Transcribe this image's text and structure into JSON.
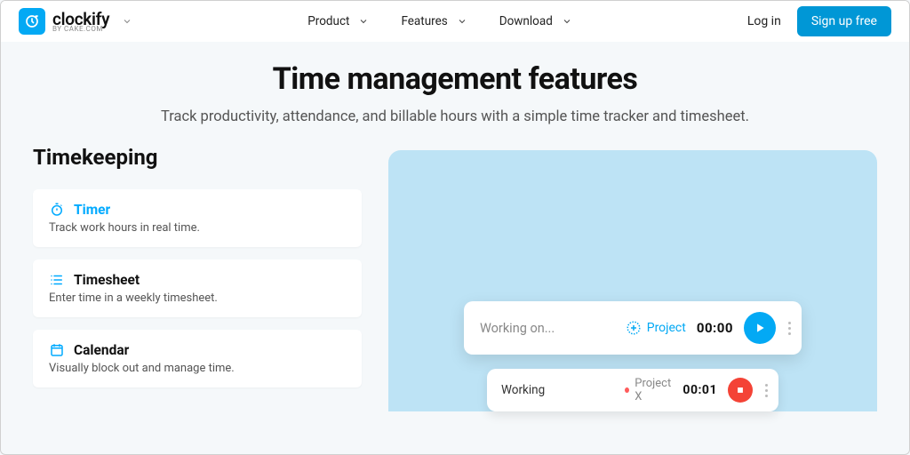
{
  "header": {
    "brand": "clockify",
    "byline": "BY CAKE.COM",
    "nav": [
      "Product",
      "Features",
      "Download"
    ],
    "login": "Log in",
    "signup": "Sign up free"
  },
  "hero": {
    "title": "Time management features",
    "subtitle": "Track productivity, attendance, and billable hours with a simple time tracker and timesheet."
  },
  "sidebar": {
    "heading": "Timekeeping",
    "items": [
      {
        "title": "Timer",
        "desc": "Track work hours in real time.",
        "active": true,
        "icon": "stopwatch"
      },
      {
        "title": "Timesheet",
        "desc": "Enter time in a weekly timesheet.",
        "active": false,
        "icon": "list"
      },
      {
        "title": "Calendar",
        "desc": "Visually block out and manage time.",
        "active": false,
        "icon": "calendar"
      }
    ]
  },
  "preview": {
    "new_entry": {
      "placeholder": "Working on...",
      "project_label": "Project",
      "time": "00:00"
    },
    "running_entry": {
      "title": "Working",
      "project": "Project X",
      "time": "00:01"
    }
  },
  "colors": {
    "accent": "#03a9f4",
    "danger": "#f44336",
    "preview_bg": "#bde3f5"
  }
}
